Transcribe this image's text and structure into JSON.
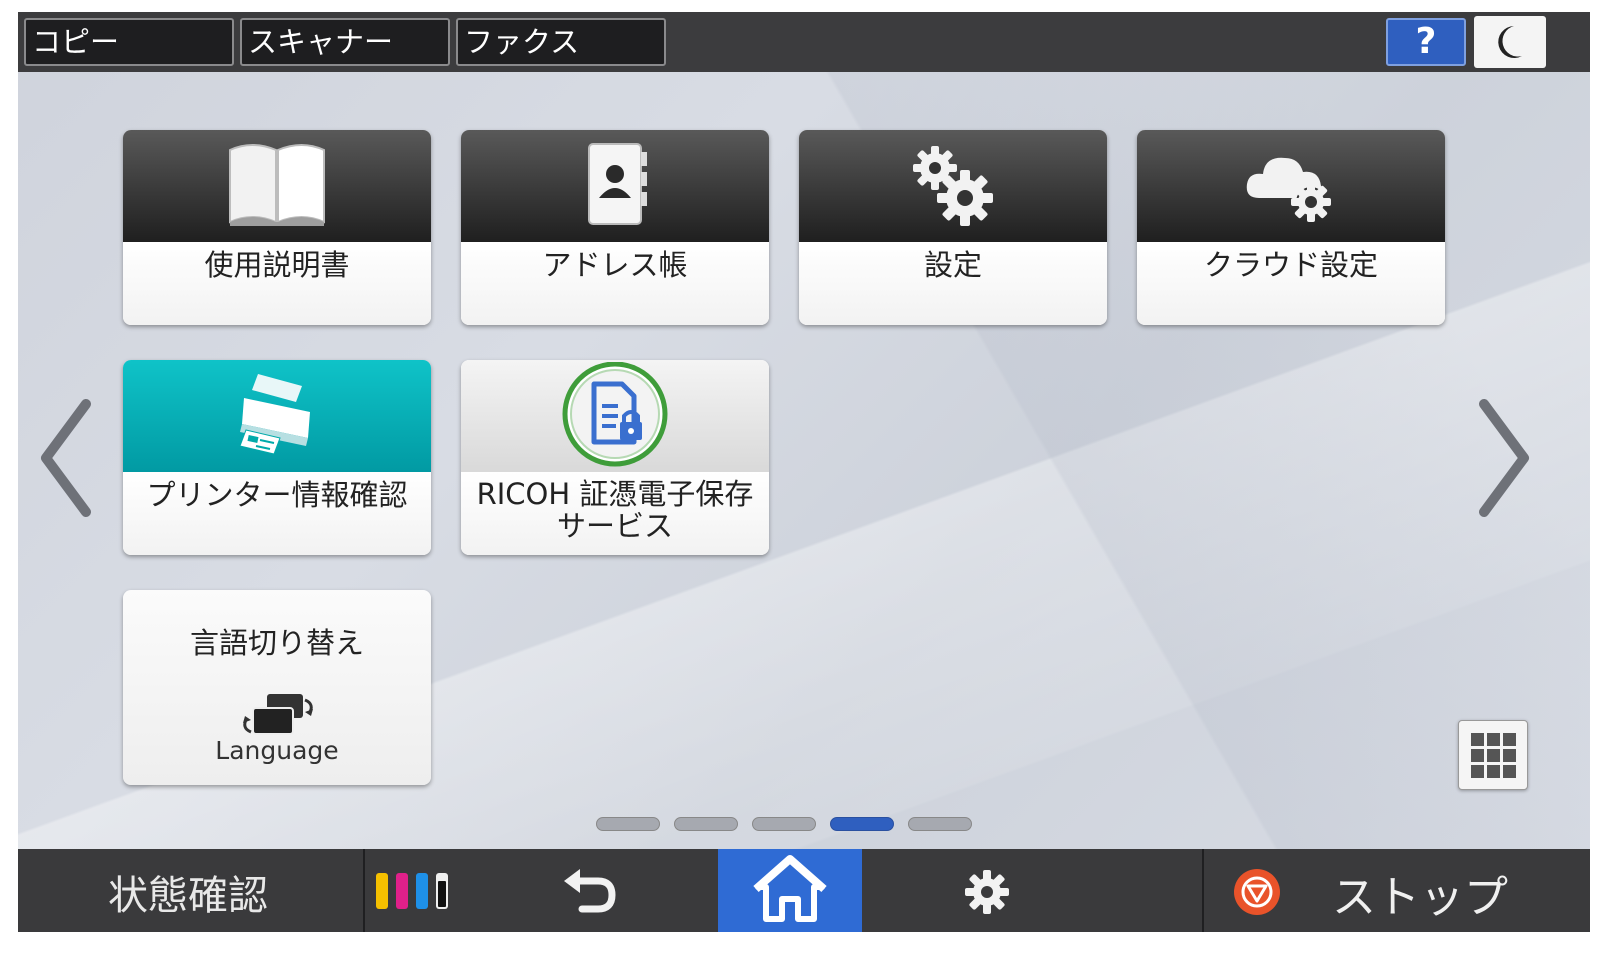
{
  "topbar": {
    "tabs": [
      {
        "label": "コピー"
      },
      {
        "label": "スキャナー"
      },
      {
        "label": "ファクス"
      }
    ],
    "help_label": "?"
  },
  "tiles": [
    {
      "label": "使用説明書",
      "icon": "book-icon"
    },
    {
      "label": "アドレス帳",
      "icon": "address-book-icon"
    },
    {
      "label": "設定",
      "icon": "gears-icon"
    },
    {
      "label": "クラウド設定",
      "icon": "cloud-gear-icon"
    },
    {
      "label": "プリンター情報確認",
      "icon": "printer-icon"
    },
    {
      "label": "RICOH 証憑電子保存サービス",
      "icon": "document-lock-icon"
    }
  ],
  "language_tile": {
    "title": "言語切り替え",
    "subtitle": "Language"
  },
  "pagination": {
    "count": 5,
    "active_index": 3
  },
  "bottombar": {
    "status_label": "状態確認",
    "stop_label": "ストップ"
  },
  "colors": {
    "accent": "#2f6bd4",
    "ink_yellow": "#f5c000",
    "ink_magenta": "#e0208a",
    "ink_cyan": "#1e90e8",
    "ink_black": "#111111",
    "stop": "#e9532a"
  }
}
